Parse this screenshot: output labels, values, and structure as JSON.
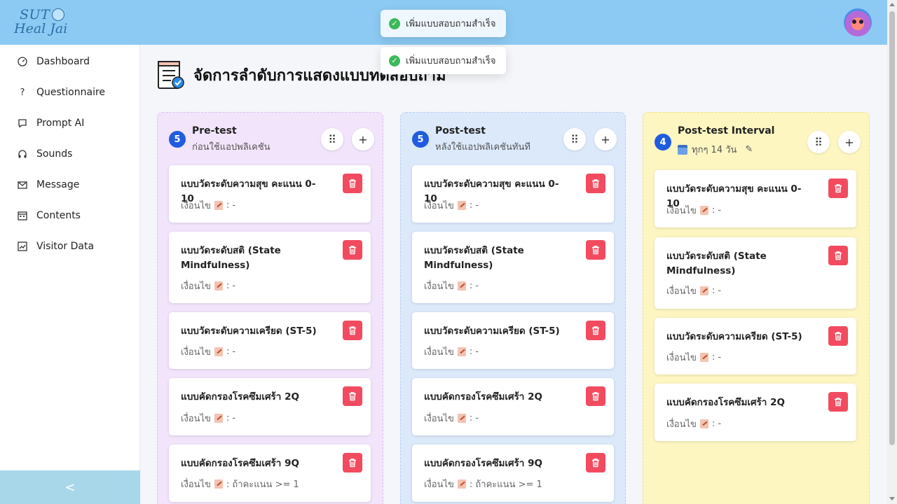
{
  "app": {
    "logo_line1": "SUT",
    "logo_line2": "Heal Jai"
  },
  "toasts": [
    {
      "message": "เพิ่มแบบสอบถามสำเร็จ"
    },
    {
      "message": "เพิ่มแบบสอบถามสำเร็จ"
    }
  ],
  "sidebar": {
    "items": [
      {
        "label": "Dashboard",
        "icon": "dashboard-gauge-icon"
      },
      {
        "label": "Questionnaire",
        "icon": "question-mark-icon"
      },
      {
        "label": "Prompt AI",
        "icon": "chat-bubble-icon"
      },
      {
        "label": "Sounds",
        "icon": "headphones-icon"
      },
      {
        "label": "Message",
        "icon": "envelope-icon"
      },
      {
        "label": "Contents",
        "icon": "calendar-grid-icon"
      },
      {
        "label": "Visitor Data",
        "icon": "line-chart-icon"
      }
    ],
    "collapse_label": "<"
  },
  "page": {
    "title": "จัดการลำดับการแสดงแบบทดสอบถาม"
  },
  "columns": {
    "pre": {
      "count": "5",
      "title": "Pre-test",
      "subtitle": "ก่อนใช้แอปพลิเคชัน",
      "color": "#f2e4fb",
      "cards": [
        {
          "title": "แบบวัดระดับความสุข คะแนน 0-10",
          "cond_label": "เงื่อนไข",
          "cond_value": ": -"
        },
        {
          "title": "แบบวัดระดับสติ (State Mindfulness)",
          "cond_label": "เงื่อนไข",
          "cond_value": ": -"
        },
        {
          "title": "แบบวัดระดับความเครียด (ST-5)",
          "cond_label": "เงื่อนไข",
          "cond_value": ": -"
        },
        {
          "title": "แบบคัดกรองโรคซึมเศร้า 2Q",
          "cond_label": "เงื่อนไข",
          "cond_value": ": -"
        },
        {
          "title": "แบบคัดกรองโรคซึมเศร้า 9Q",
          "cond_label": "เงื่อนไข",
          "cond_value": ": ถ้าคะแนน >= 1"
        }
      ]
    },
    "post": {
      "count": "5",
      "title": "Post-test",
      "subtitle": "หลังใช้แอปพลิเคชันทันที",
      "color": "#dce9fb",
      "cards": [
        {
          "title": "แบบวัดระดับความสุข คะแนน 0-10",
          "cond_label": "เงื่อนไข",
          "cond_value": ": -"
        },
        {
          "title": "แบบวัดระดับสติ (State Mindfulness)",
          "cond_label": "เงื่อนไข",
          "cond_value": ": -"
        },
        {
          "title": "แบบวัดระดับความเครียด (ST-5)",
          "cond_label": "เงื่อนไข",
          "cond_value": ": -"
        },
        {
          "title": "แบบคัดกรองโรคซึมเศร้า 2Q",
          "cond_label": "เงื่อนไข",
          "cond_value": ": -"
        },
        {
          "title": "แบบคัดกรองโรคซึมเศร้า 9Q",
          "cond_label": "เงื่อนไข",
          "cond_value": ": ถ้าคะแนน >= 1"
        }
      ]
    },
    "interval": {
      "count": "4",
      "title": "Post-test Interval",
      "subtitle": "ทุกๆ 14 วัน",
      "color": "#fdf6c1",
      "cards": [
        {
          "title": "แบบวัดระดับความสุข คะแนน 0-10",
          "cond_label": "เงื่อนไข",
          "cond_value": ": -"
        },
        {
          "title": "แบบวัดระดับสติ (State Mindfulness)",
          "cond_label": "เงื่อนไข",
          "cond_value": ": -"
        },
        {
          "title": "แบบวัดระดับความเครียด (ST-5)",
          "cond_label": "เงื่อนไข",
          "cond_value": ": -"
        },
        {
          "title": "แบบคัดกรองโรคซึมเศร้า 2Q",
          "cond_label": "เงื่อนไข",
          "cond_value": ": -"
        }
      ]
    }
  },
  "colors": {
    "topbar": "#8ccaf3",
    "badge": "#1f5ce0",
    "delete": "#f24b5f",
    "success": "#3cb95a"
  }
}
